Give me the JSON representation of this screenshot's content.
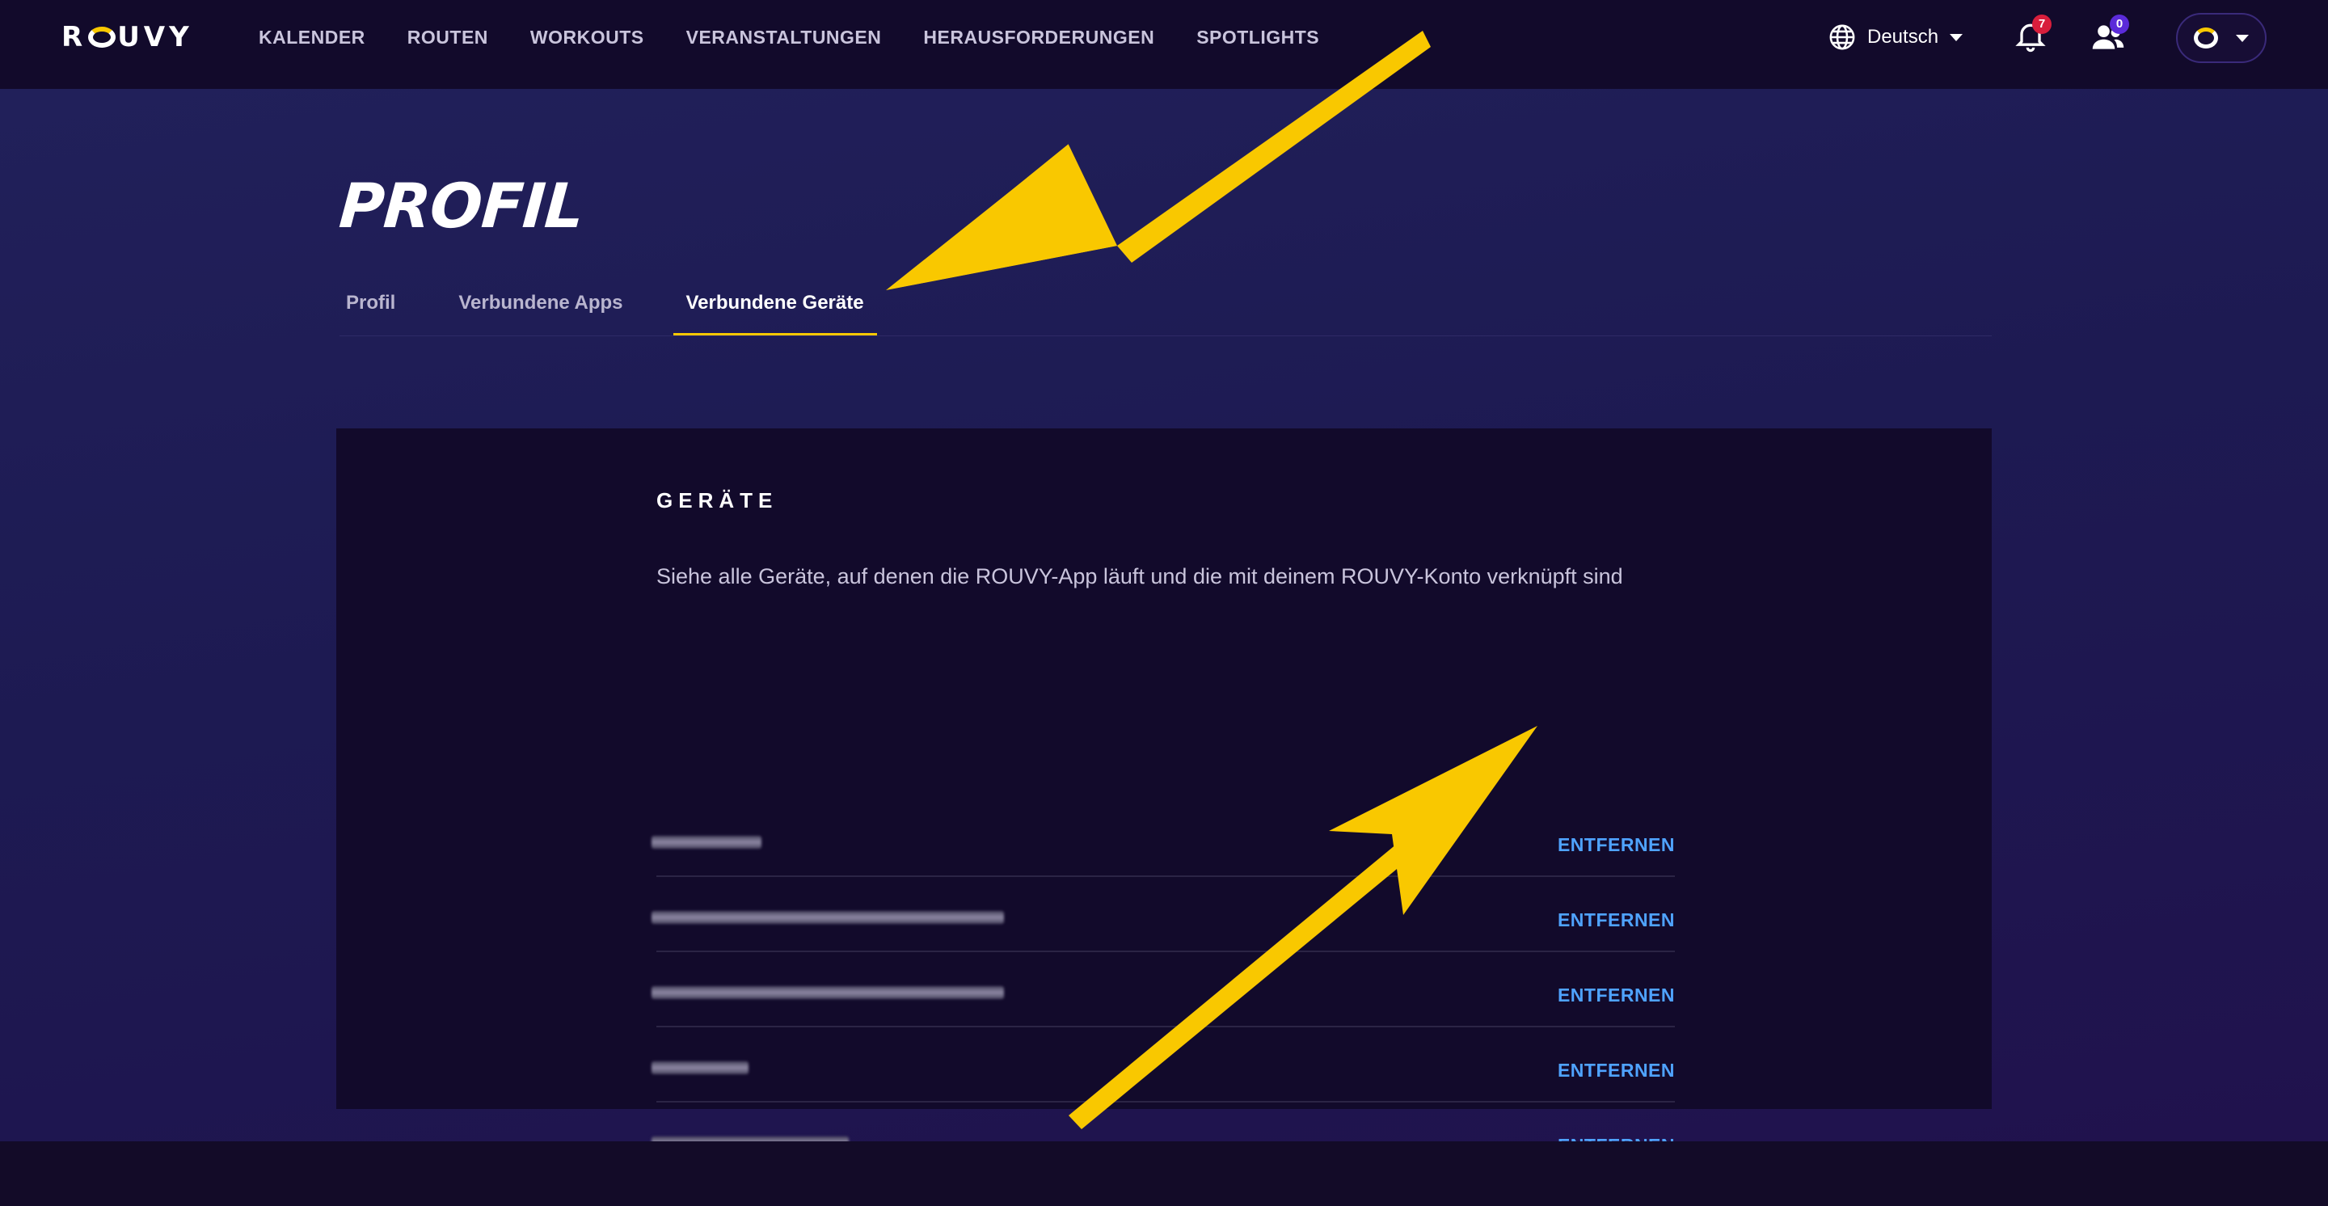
{
  "brand": {
    "name": "ROUVY"
  },
  "nav": {
    "items": [
      "KALENDER",
      "ROUTEN",
      "WORKOUTS",
      "VERANSTALTUNGEN",
      "HERAUSFORDERUNGEN",
      "SPOTLIGHTS"
    ]
  },
  "header": {
    "language": "Deutsch",
    "notifications_count": "7",
    "friends_count": "0"
  },
  "page": {
    "title": "PROFIL",
    "tabs": [
      {
        "label": "Profil",
        "active": false
      },
      {
        "label": "Verbundene Apps",
        "active": false
      },
      {
        "label": "Verbundene Geräte",
        "active": true
      }
    ]
  },
  "devices": {
    "title": "GERÄTE",
    "description": "Siehe alle Geräte, auf denen die ROUVY-App läuft und die mit deinem ROUVY-Konto verknüpft sind",
    "remove_label": "ENTFERNEN",
    "items": [
      {
        "name": "[redacted]"
      },
      {
        "name": "[redacted]"
      },
      {
        "name": "[redacted]"
      },
      {
        "name": "[redacted]"
      },
      {
        "name": "[redacted]"
      }
    ]
  },
  "colors": {
    "accent": "#f9c800",
    "link": "#4fa3ff",
    "background": "#130b2a",
    "notification_badge": "#d81e3c",
    "friends_badge": "#5b2bd9"
  }
}
